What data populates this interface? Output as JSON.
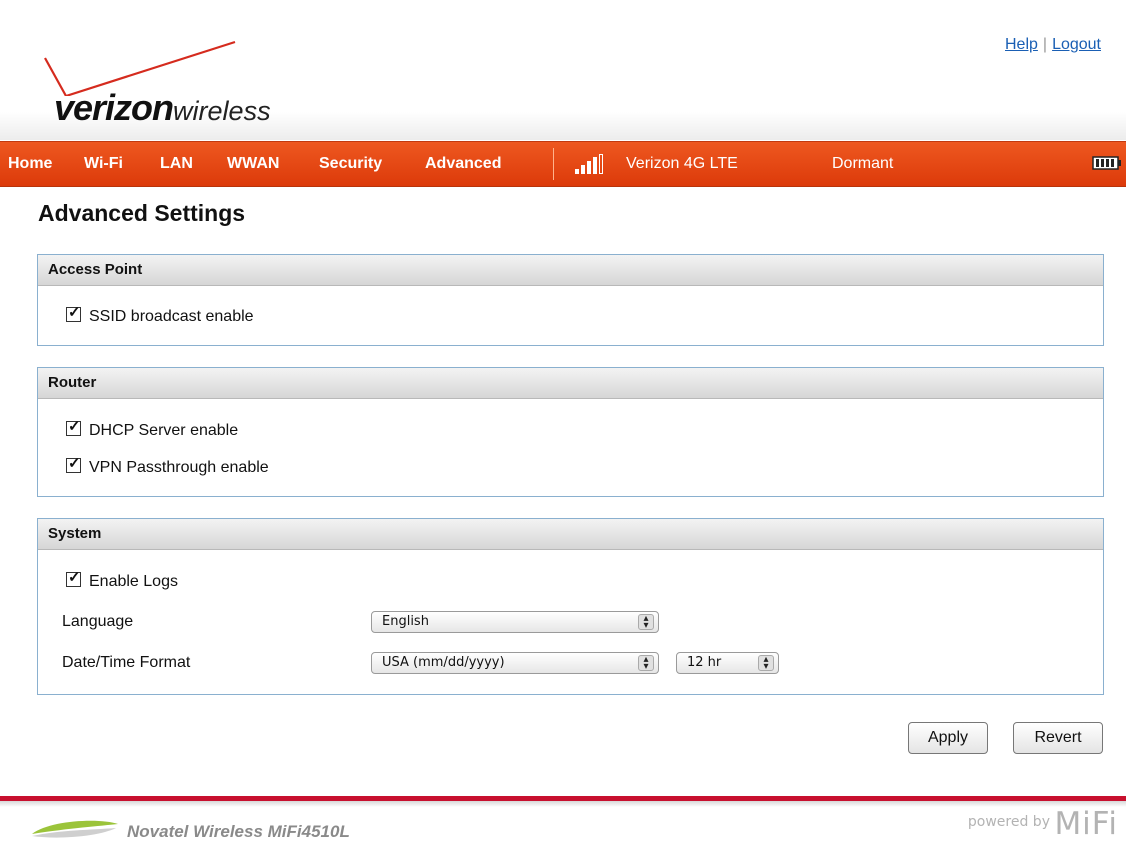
{
  "header": {
    "logo": {
      "brand": "verizon",
      "sub": "wireless"
    },
    "links": {
      "help": "Help",
      "separator": "|",
      "logout": "Logout"
    }
  },
  "nav": {
    "items": [
      {
        "label": "Home"
      },
      {
        "label": "Wi-Fi"
      },
      {
        "label": "LAN"
      },
      {
        "label": "WWAN"
      },
      {
        "label": "Security"
      },
      {
        "label": "Advanced"
      }
    ],
    "status": {
      "signal_icon": "signal-bars-icon",
      "signal_bars": 4,
      "network": "Verizon  4G LTE",
      "connection": "Dormant",
      "battery_icon": "battery-icon"
    }
  },
  "page": {
    "title": "Advanced Settings"
  },
  "sections": {
    "access_point": {
      "title": "Access Point",
      "ssid_broadcast": {
        "label": "SSID broadcast enable",
        "checked": true
      }
    },
    "router": {
      "title": "Router",
      "dhcp": {
        "label": "DHCP Server enable",
        "checked": true
      },
      "vpn": {
        "label": "VPN Passthrough enable",
        "checked": true
      }
    },
    "system": {
      "title": "System",
      "logs": {
        "label": "Enable Logs",
        "checked": true
      },
      "language": {
        "label": "Language",
        "value": "English"
      },
      "datetime": {
        "label": "Date/Time Format",
        "value": "USA (mm/dd/yyyy)",
        "hour_value": "12 hr"
      }
    }
  },
  "buttons": {
    "apply": "Apply",
    "revert": "Revert"
  },
  "footer": {
    "product": "Novatel Wireless MiFi4510L",
    "powered_by": "powered by",
    "powered_brand": "MiFi"
  },
  "colors": {
    "nav_orange": "#e64a14",
    "footer_red": "#c8102e",
    "panel_border": "#8ab0cf",
    "link_blue": "#1a5fb4"
  }
}
